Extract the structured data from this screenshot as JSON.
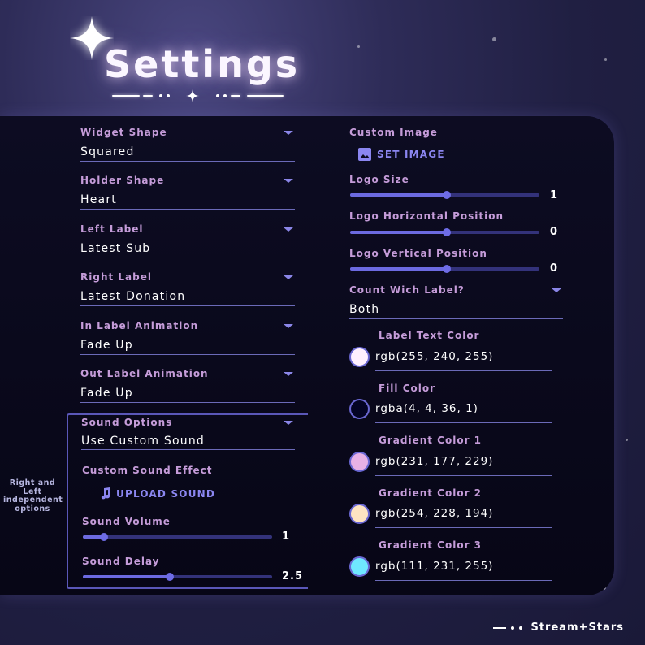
{
  "header": {
    "title": "Settings"
  },
  "left": {
    "fields": [
      {
        "label": "Widget Shape",
        "value": "Squared"
      },
      {
        "label": "Holder Shape",
        "value": "Heart"
      },
      {
        "label": "Left Label",
        "value": "Latest Sub"
      },
      {
        "label": "Right Label",
        "value": "Latest Donation"
      },
      {
        "label": "In Label Animation",
        "value": "Fade Up"
      },
      {
        "label": "Out Label Animation",
        "value": "Fade Up"
      }
    ],
    "sound": {
      "options_label": "Sound Options",
      "options_value": "Use Custom Sound",
      "effect_label": "Custom Sound Effect",
      "upload_button": "UPLOAD SOUND",
      "volume_label": "Sound Volume",
      "volume_value": "1",
      "volume_fraction": 0.11,
      "delay_label": "Sound Delay",
      "delay_value": "2.5",
      "delay_fraction": 0.46
    },
    "side_note": "Right and Left independent options"
  },
  "right": {
    "custom_image_label": "Custom Image",
    "set_image_button": "SET IMAGE",
    "logo_size_label": "Logo Size",
    "logo_size_value": "1",
    "logo_size_fraction": 0.51,
    "logo_h_label": "Logo Horizontal Position",
    "logo_h_value": "0",
    "logo_h_fraction": 0.51,
    "logo_v_label": "Logo Vertical Position",
    "logo_v_value": "0",
    "logo_v_fraction": 0.51,
    "count_label": "Count Wich Label?",
    "count_value": "Both",
    "colors": [
      {
        "label": "Label Text Color",
        "value": "rgb(255, 240, 255)",
        "hex": "#fff0ff"
      },
      {
        "label": "Fill Color",
        "value": "rgba(4, 4, 36, 1)",
        "hex": "#040424"
      },
      {
        "label": "Gradient Color 1",
        "value": "rgb(231, 177, 229)",
        "hex": "#e7b1e5"
      },
      {
        "label": "Gradient Color 2",
        "value": "rgb(254, 228, 194)",
        "hex": "#fee4c2"
      },
      {
        "label": "Gradient Color 3",
        "value": "rgb(111, 231, 255)",
        "hex": "#6fe7ff"
      }
    ]
  },
  "footer": {
    "brand": "Stream+Stars"
  },
  "icons": {
    "sparkle": "four-point-star-icon",
    "image": "image-icon",
    "music": "music-note-icon",
    "caret": "caret-down-icon"
  }
}
